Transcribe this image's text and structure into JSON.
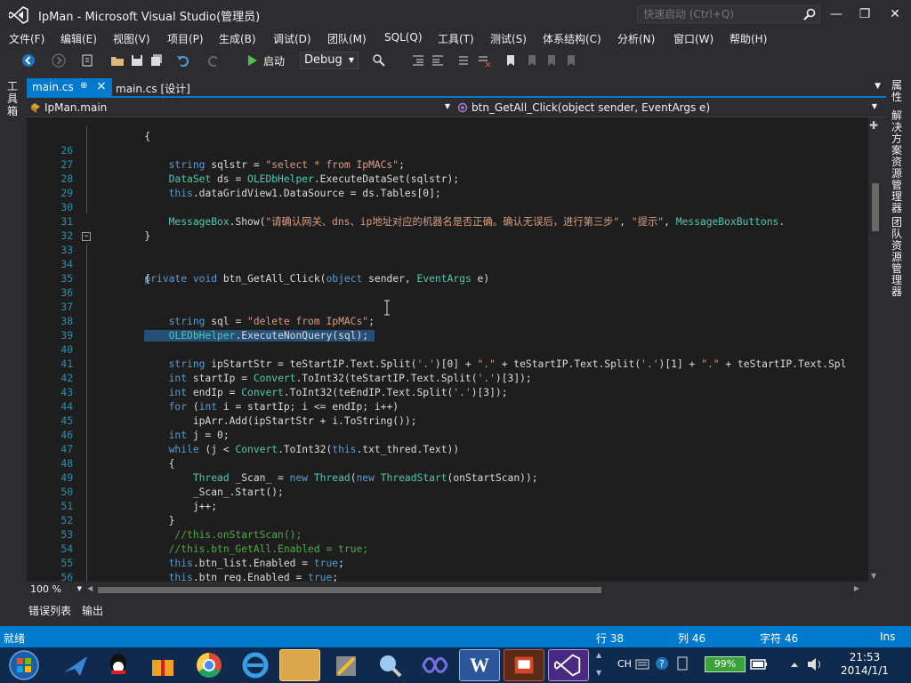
{
  "window": {
    "title": "IpMan - Microsoft Visual Studio(管理员)",
    "quick_launch_placeholder": "快速启动 (Ctrl+Q)"
  },
  "menu": [
    "文件(F)",
    "编辑(E)",
    "视图(V)",
    "项目(P)",
    "生成(B)",
    "调试(D)",
    "团队(M)",
    "SQL(Q)",
    "工具(T)",
    "测试(S)",
    "体系结构(C)",
    "分析(N)",
    "窗口(W)",
    "帮助(H)"
  ],
  "toolbar": {
    "start_label": "启动",
    "config_value": "Debug"
  },
  "side_panels": {
    "left": "工具箱",
    "right_1": "属性",
    "right_2": "解决方案资源管理器",
    "right_3": "团队资源管理器"
  },
  "tabs": [
    {
      "label": "main.cs"
    },
    {
      "label": "main.cs [设计]"
    }
  ],
  "nav": {
    "class_scope": "IpMan.main",
    "member_scope": "btn_GetAll_Click(object sender, EventArgs e)"
  },
  "code_lines": [
    {
      "n": "26",
      "text": "            string sqlstr = \"select * from IpMACs\";"
    },
    {
      "n": "27",
      "text": "            DataSet ds = OLEDbHelper.ExecuteDataSet(sqlstr);"
    },
    {
      "n": "28",
      "text": "            this.dataGridView1.DataSource = ds.Tables[0];"
    },
    {
      "n": "29",
      "text": ""
    },
    {
      "n": "30",
      "text": "            MessageBox.Show(\"请确认网关、dns、ip地址对应的机器名是否正确。确认无误后，进行第三步\", \"提示\", MessageBoxButtons."
    },
    {
      "n": "31",
      "text": "        }"
    },
    {
      "n": "32",
      "text": ""
    },
    {
      "n": "33",
      "text": "        private void btn_GetAll_Click(object sender, EventArgs e)"
    },
    {
      "n": "34",
      "text": "        {"
    },
    {
      "n": "35",
      "text": ""
    },
    {
      "n": "36",
      "text": ""
    },
    {
      "n": "37",
      "text": "            string sql = \"delete from IpMACs\";"
    },
    {
      "n": "38",
      "text": "            OLEDbHelper.ExecuteNonQuery(sql);"
    },
    {
      "n": "39",
      "text": ""
    },
    {
      "n": "40",
      "text": "            string ipStartStr = teStartIP.Text.Split('.')[0] + \".\" + teStartIP.Text.Split('.')[1] + \".\" + teStartIP.Text.Spl"
    },
    {
      "n": "41",
      "text": "            int startIp = Convert.ToInt32(teStartIP.Text.Split('.')[3]);"
    },
    {
      "n": "42",
      "text": "            int endIp = Convert.ToInt32(teEndIP.Text.Split('.')[3]);"
    },
    {
      "n": "43",
      "text": "            for (int i = startIp; i <= endIp; i++)"
    },
    {
      "n": "44",
      "text": "                ipArr.Add(ipStartStr + i.ToString());"
    },
    {
      "n": "45",
      "text": "            int j = 0;"
    },
    {
      "n": "46",
      "text": "            while (j < Convert.ToInt32(this.txt_thred.Text))"
    },
    {
      "n": "47",
      "text": "            {"
    },
    {
      "n": "48",
      "text": "                Thread _Scan_ = new Thread(new ThreadStart(onStartScan));"
    },
    {
      "n": "49",
      "text": "                _Scan_.Start();"
    },
    {
      "n": "50",
      "text": "                j++;"
    },
    {
      "n": "51",
      "text": "            }"
    },
    {
      "n": "52",
      "text": "             //this.onStartScan();"
    },
    {
      "n": "53",
      "text": "            //this.btn_GetAll.Enabled = true;"
    },
    {
      "n": "54",
      "text": "            this.btn_list.Enabled = true;"
    },
    {
      "n": "55",
      "text": "            this.btn_reg.Enabled = true;"
    },
    {
      "n": "56",
      "text": ""
    },
    {
      "n": "57",
      "text": ""
    }
  ],
  "top_partial_line": "        {",
  "zoom": "100 %",
  "bottom_tabs": [
    "错误列表",
    "输出"
  ],
  "status": {
    "ready": "就绪",
    "row": "行 38",
    "col": "列 46",
    "ch": "字符 46",
    "mode": "Ins"
  },
  "taskbar": {
    "battery": "99%",
    "lang": "CH",
    "time": "21:53",
    "date": "2014/1/1"
  },
  "colors": {
    "accent": "#007acc",
    "editor_bg": "#1e1e1e",
    "chrome_bg": "#2d2d30",
    "keyword": "#569cd6",
    "type": "#4ec9b0",
    "string": "#d69d85",
    "comment": "#57a64a",
    "selection": "#264f78"
  }
}
